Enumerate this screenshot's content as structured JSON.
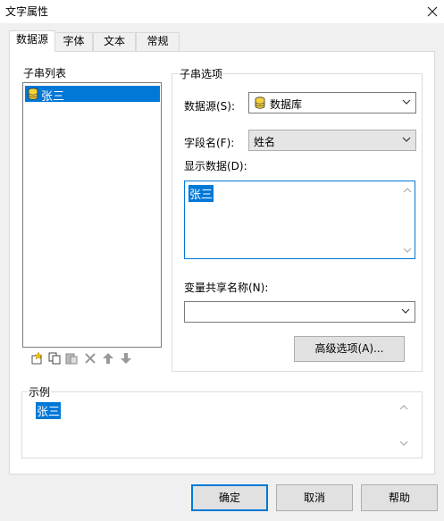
{
  "window": {
    "title": "文字属性"
  },
  "tabs": [
    {
      "label": "数据源"
    },
    {
      "label": "字体"
    },
    {
      "label": "文本"
    },
    {
      "label": "常规"
    }
  ],
  "substring_list": {
    "label": "子串列表",
    "items": [
      {
        "label": "张三",
        "icon": "database-icon"
      }
    ]
  },
  "substring_options": {
    "label": "子串选项",
    "datasource_label": "数据源(S):",
    "datasource_value": "数据库",
    "field_label": "字段名(F):",
    "field_value": "姓名",
    "display_label": "显示数据(D):",
    "display_value": "张三",
    "share_label": "变量共享名称(N):",
    "share_value": "",
    "advanced_button": "高级选项(A)..."
  },
  "toolbar": {
    "icons": [
      "new-icon",
      "copy-icon",
      "paste-icon",
      "delete-icon",
      "move-up-icon",
      "move-down-icon"
    ]
  },
  "example": {
    "label": "示例",
    "value": "张三"
  },
  "buttons": {
    "ok": "确定",
    "cancel": "取消",
    "help": "帮助"
  },
  "colors": {
    "accent": "#0078d7",
    "background": "#f0f0f0"
  }
}
